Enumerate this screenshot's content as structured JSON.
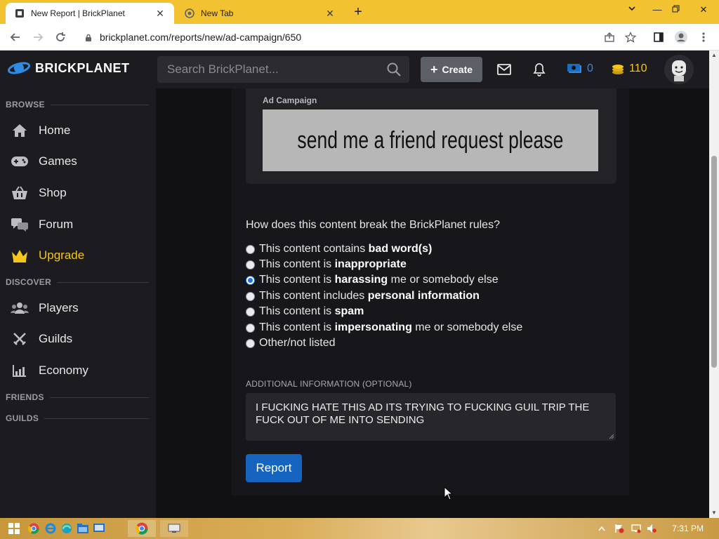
{
  "browser": {
    "tabs": [
      {
        "title": "New Report | BrickPlanet",
        "active": true
      },
      {
        "title": "New Tab",
        "active": false
      }
    ],
    "url": "brickplanet.com/reports/new/ad-campaign/650"
  },
  "header": {
    "logo_text": "BRICKPLANET",
    "search_placeholder": "Search BrickPlanet...",
    "create_label": "Create",
    "bucks_count": "0",
    "coins_count": "110"
  },
  "sidebar": {
    "sections": {
      "browse": "BROWSE",
      "discover": "DISCOVER",
      "friends": "FRIENDS",
      "guilds": "GUILDS"
    },
    "items": {
      "home": "Home",
      "games": "Games",
      "shop": "Shop",
      "forum": "Forum",
      "upgrade": "Upgrade",
      "players": "Players",
      "guilds": "Guilds",
      "economy": "Economy"
    }
  },
  "report": {
    "ad_label": "Ad Campaign",
    "ad_text": "send me a friend request please",
    "question": "How does this content break the BrickPlanet rules?",
    "options": [
      {
        "prefix": "This content contains ",
        "bold": "bad word(s)",
        "suffix": "",
        "checked": false
      },
      {
        "prefix": "This content is ",
        "bold": "inappropriate",
        "suffix": "",
        "checked": false
      },
      {
        "prefix": "This content is ",
        "bold": "harassing",
        "suffix": " me or somebody else",
        "checked": true
      },
      {
        "prefix": "This content includes ",
        "bold": "personal information",
        "suffix": "",
        "checked": false
      },
      {
        "prefix": "This content is ",
        "bold": "spam",
        "suffix": "",
        "checked": false
      },
      {
        "prefix": "This content is ",
        "bold": "impersonating",
        "suffix": " me or somebody else",
        "checked": false
      },
      {
        "prefix": "Other/not listed",
        "bold": "",
        "suffix": "",
        "checked": false
      }
    ],
    "additional_label": "ADDITIONAL INFORMATION (OPTIONAL)",
    "additional_value": "I FUCKING HATE THIS AD ITS TRYING TO FUCKING GUIL TRIP THE FUCK OUT OF ME INTO SENDING",
    "submit_label": "Report"
  },
  "taskbar": {
    "clock": "7:31 PM"
  },
  "colors": {
    "accent_blue": "#1565c0",
    "upgrade_gold": "#f5c518",
    "tab_bar": "#f2c230"
  }
}
